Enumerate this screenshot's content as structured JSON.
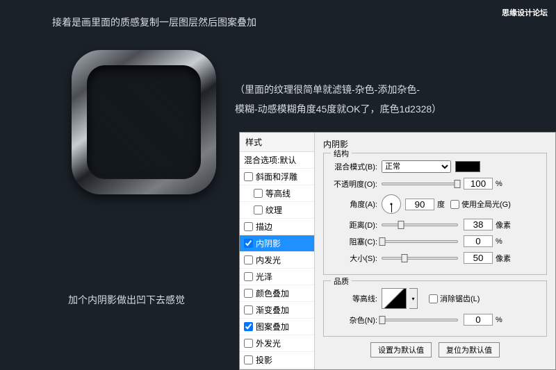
{
  "topText": "接着是画里面的质感复制一层图层然后图案叠加",
  "watermark": "思缘设计论坛",
  "descLine1": "（里面的纹理很简单就滤镜-杂色-添加杂色-",
  "descLine2": "模糊-动感模糊角度45度就OK了，底色1d2328）",
  "bottomText": "加个内阴影做出凹下去感觉",
  "styleHeader": "样式",
  "styles": {
    "blendDefault": "混合选项:默认",
    "bevelEmboss": "斜面和浮雕",
    "contourSub": "等高线",
    "textureSub": "纹理",
    "stroke": "描边",
    "innerShadow": "内阴影",
    "innerGlow": "内发光",
    "satin": "光泽",
    "colorOverlay": "颜色叠加",
    "gradientOverlay": "渐变叠加",
    "patternOverlay": "图案叠加",
    "outerGlow": "外发光",
    "dropShadow": "投影"
  },
  "settingsTitle": "内阴影",
  "structure": {
    "legend": "结构",
    "blendModeLabel": "混合模式(B):",
    "blendModeValue": "正常",
    "opacityLabel": "不透明度(O):",
    "opacityValue": "100",
    "opacityUnit": "%",
    "angleLabel": "角度(A):",
    "angleValue": "90",
    "angleUnit": "度",
    "globalLight": "使用全局光(G)",
    "distanceLabel": "距离(D):",
    "distanceValue": "38",
    "distanceUnit": "像素",
    "chokeLabel": "阻塞(C):",
    "chokeValue": "0",
    "chokeUnit": "%",
    "sizeLabel": "大小(S):",
    "sizeValue": "50",
    "sizeUnit": "像素"
  },
  "quality": {
    "legend": "品质",
    "contourLabel": "等高线:",
    "antiAlias": "消除锯齿(L)",
    "noiseLabel": "杂色(N):",
    "noiseValue": "0",
    "noiseUnit": "%"
  },
  "buttons": {
    "setDefault": "设置为默认值",
    "resetDefault": "复位为默认值"
  }
}
